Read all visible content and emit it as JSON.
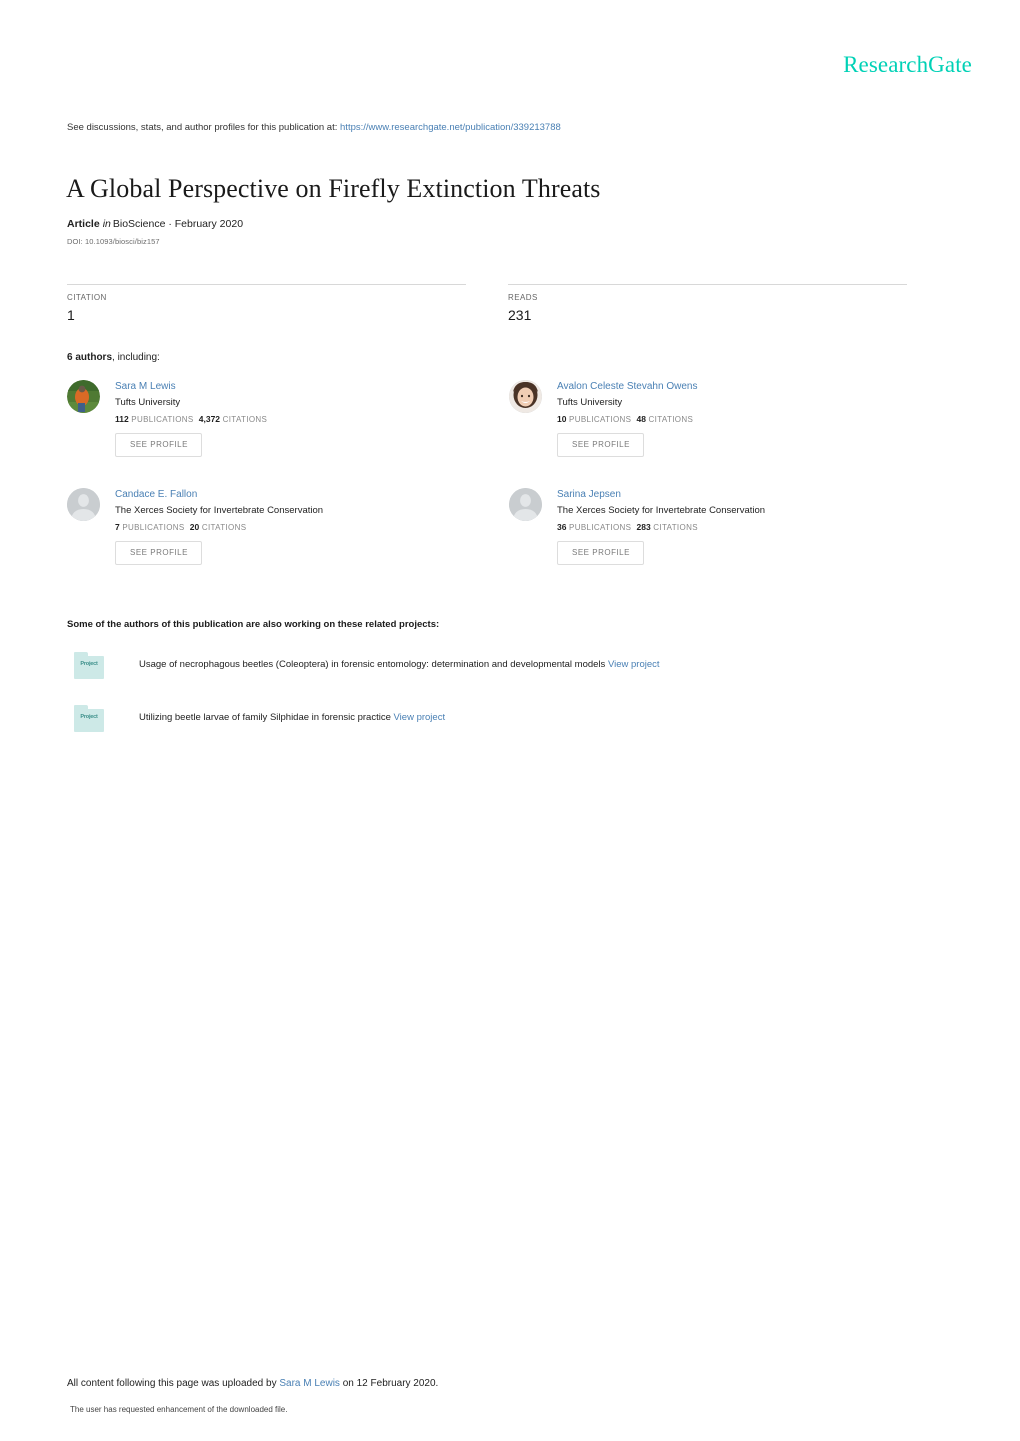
{
  "brand": {
    "logo_text": "ResearchGate",
    "logo_color": "#00d1b6"
  },
  "discussion": {
    "prefix": "See discussions, stats, and author profiles for this publication at:",
    "url": "https://www.researchgate.net/publication/339213788",
    "url_color": "#4a80b4"
  },
  "publication": {
    "title": "A Global Perspective on Firefly Extinction Threats",
    "type_label": "Article",
    "in_word": "in",
    "venue": "BioScience · February 2020",
    "doi": "DOI: 10.1093/biosci/biz157"
  },
  "stats": [
    {
      "label": "CITATION",
      "value": "1"
    },
    {
      "label": "READS",
      "value": "231"
    }
  ],
  "authors_section": {
    "count_label": "6 authors",
    "count_suffix": ", including:",
    "see_profile_label": "SEE PROFILE",
    "authors": [
      {
        "name": "Sara M Lewis",
        "affiliation": "Tufts University",
        "publications": "112",
        "publications_label": "PUBLICATIONS",
        "citations": "4,372",
        "citations_label": "CITATIONS",
        "avatar_type": "photo-person-field"
      },
      {
        "name": "Avalon Celeste Stevahn Owens",
        "affiliation": "Tufts University",
        "publications": "10",
        "publications_label": "PUBLICATIONS",
        "citations": "48",
        "citations_label": "CITATIONS",
        "avatar_type": "photo-portrait"
      },
      {
        "name": "Candace E. Fallon",
        "affiliation": "The Xerces Society for Invertebrate Conservation",
        "publications": "7",
        "publications_label": "PUBLICATIONS",
        "citations": "20",
        "citations_label": "CITATIONS",
        "avatar_type": "placeholder"
      },
      {
        "name": "Sarina Jepsen",
        "affiliation": "The Xerces Society for Invertebrate Conservation",
        "publications": "36",
        "publications_label": "PUBLICATIONS",
        "citations": "283",
        "citations_label": "CITATIONS",
        "avatar_type": "placeholder"
      }
    ]
  },
  "projects_section": {
    "heading": "Some of the authors of this publication are also working on these related projects:",
    "icon_label": "Project",
    "view_link_label": "View project",
    "projects": [
      {
        "title": "Usage of necrophagous beetles (Coleoptera) in forensic entomology: determination and developmental models"
      },
      {
        "title": "Utilizing beetle larvae of family Silphidae in forensic practice"
      }
    ]
  },
  "footer": {
    "main_prefix": "All content following this page was uploaded by ",
    "uploader": "Sara M Lewis",
    "main_suffix": " on 12 February 2020.",
    "sub": "The user has requested enhancement of the downloaded file."
  }
}
